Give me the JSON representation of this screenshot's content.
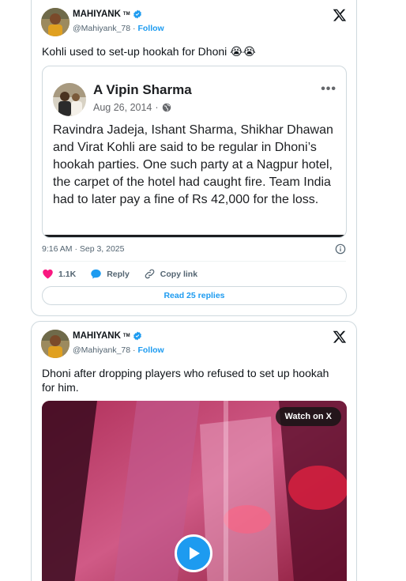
{
  "tweets": [
    {
      "display_name": "MAHIYANK",
      "name_suffix": "TM",
      "handle": "@Mahiyank_78",
      "separator": "·",
      "follow_label": "Follow",
      "text": "Kohli used to set-up hookah for Dhoni 😭😭",
      "quote": {
        "name": "A Vipin Sharma",
        "date": "Aug 26, 2014",
        "separator": "·",
        "body": "Ravindra Jadeja, Ishant Sharma, Shikhar Dhawan and Virat Kohli are said to be regular in Dhoni’s hookah parties. One such party at a Nagpur hotel, the carpet of the hotel had caught fire. Team India had to later pay a fine of Rs 42,000 for the loss."
      },
      "timestamp": "9:16 AM · Sep 3, 2025",
      "likes": "1.1K",
      "reply_label": "Reply",
      "copy_link_label": "Copy link",
      "read_replies_label": "Read 25 replies"
    },
    {
      "display_name": "MAHIYANK",
      "name_suffix": "TM",
      "handle": "@Mahiyank_78",
      "separator": "·",
      "follow_label": "Follow",
      "text": "Dhoni after dropping players who refused to set up hookah for him.",
      "video": {
        "watch_label": "Watch on X"
      }
    }
  ],
  "colors": {
    "accent": "#1d9bf0",
    "like": "#f91880",
    "verified": "#1d9bf0"
  },
  "icons": [
    "verified-badge-icon",
    "x-logo-icon",
    "globe-icon",
    "more-icon",
    "info-icon",
    "heart-icon",
    "reply-icon",
    "link-icon",
    "play-icon"
  ]
}
